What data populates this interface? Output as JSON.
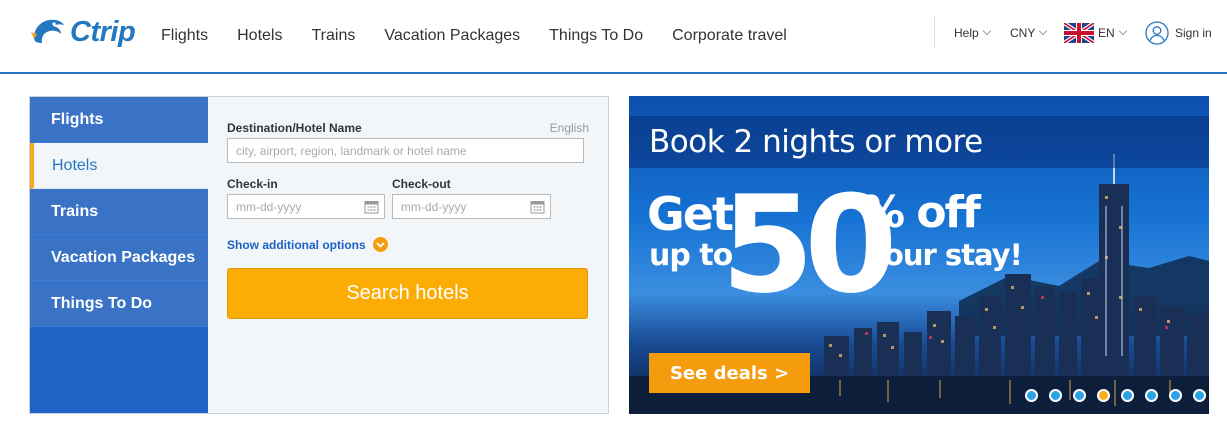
{
  "header": {
    "logo_text": "Ctrip",
    "nav": [
      "Flights",
      "Hotels",
      "Trains",
      "Vacation Packages",
      "Things To Do",
      "Corporate travel"
    ],
    "help": "Help",
    "currency": "CNY",
    "language": "EN",
    "sign_in": "Sign in"
  },
  "search_panel": {
    "sidebar": [
      "Flights",
      "Hotels",
      "Trains",
      "Vacation Packages",
      "Things To Do"
    ],
    "active_tab": "Hotels",
    "destination_label": "Destination/Hotel Name",
    "language_hint": "English",
    "destination_placeholder": "city, airport, region, landmark or hotel name",
    "checkin_label": "Check-in",
    "checkout_label": "Check-out",
    "checkin_placeholder": "mm-dd-yyyy",
    "checkout_placeholder": "mm-dd-yyyy",
    "more_options": "Show additional options",
    "search_button": "Search hotels"
  },
  "banner": {
    "headline": "Book 2 nights or more",
    "line_get": "Get",
    "line_upto": "up to",
    "big_number": "50",
    "line_pct": "% off",
    "line_stay": "your stay!",
    "cta": "See deals >",
    "slide_count": 8,
    "active_slide": 4
  },
  "colors": {
    "brand": "#2577c0",
    "sidebar": "#1f63c6",
    "accent": "#fcad05"
  }
}
